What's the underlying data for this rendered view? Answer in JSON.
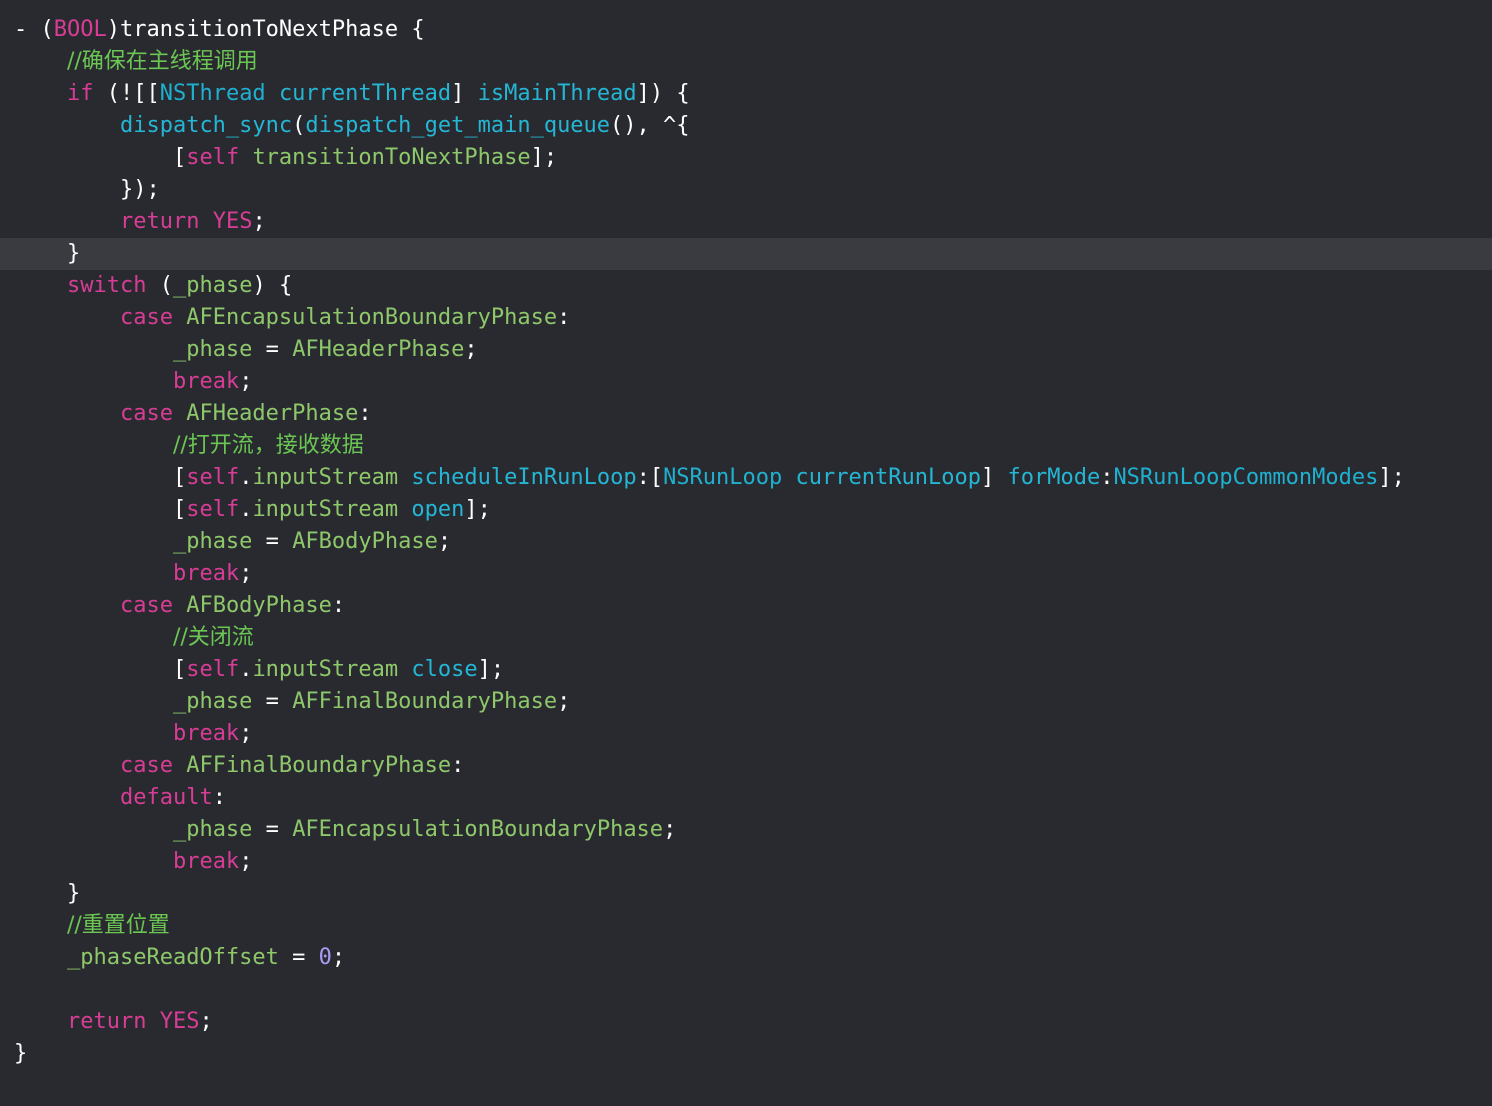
{
  "theme": {
    "background": "#292a30",
    "current_line": "#3a3b40",
    "plain": "#ffffff",
    "keyword": "#d83d96",
    "type": "#1fb0cf",
    "method": "#24b6d4",
    "project_symbol": "#8ec86a",
    "comment": "#6bc653",
    "number": "#a79df5"
  },
  "editor": {
    "current_line_index": 7,
    "lines": [
      {
        "indent": 0,
        "tokens": [
          [
            "plain",
            "- ("
          ],
          [
            "kw",
            "BOOL"
          ],
          [
            "plain",
            ")transitionToNextPhase {"
          ]
        ]
      },
      {
        "indent": 1,
        "tokens": [
          [
            "cmt",
            "//确保在主线程调用"
          ]
        ]
      },
      {
        "indent": 1,
        "tokens": [
          [
            "kw",
            "if"
          ],
          [
            "plain",
            " (![["
          ],
          [
            "type",
            "NSThread"
          ],
          [
            "plain",
            " "
          ],
          [
            "func",
            "currentThread"
          ],
          [
            "plain",
            "] "
          ],
          [
            "func",
            "isMainThread"
          ],
          [
            "plain",
            "]) {"
          ]
        ]
      },
      {
        "indent": 2,
        "tokens": [
          [
            "func",
            "dispatch_sync"
          ],
          [
            "plain",
            "("
          ],
          [
            "func",
            "dispatch_get_main_queue"
          ],
          [
            "plain",
            "(), ^{"
          ]
        ]
      },
      {
        "indent": 3,
        "tokens": [
          [
            "plain",
            "["
          ],
          [
            "kw",
            "self"
          ],
          [
            "plain",
            " "
          ],
          [
            "green",
            "transitionToNextPhase"
          ],
          [
            "plain",
            "];"
          ]
        ]
      },
      {
        "indent": 2,
        "tokens": [
          [
            "plain",
            "});"
          ]
        ]
      },
      {
        "indent": 2,
        "tokens": [
          [
            "kw",
            "return"
          ],
          [
            "plain",
            " "
          ],
          [
            "kw",
            "YES"
          ],
          [
            "plain",
            ";"
          ]
        ]
      },
      {
        "indent": 1,
        "tokens": [
          [
            "plain",
            "}"
          ]
        ]
      },
      {
        "indent": 1,
        "tokens": [
          [
            "kw",
            "switch"
          ],
          [
            "plain",
            " ("
          ],
          [
            "green",
            "_phase"
          ],
          [
            "plain",
            ") {"
          ]
        ]
      },
      {
        "indent": 2,
        "tokens": [
          [
            "kw",
            "case"
          ],
          [
            "plain",
            " "
          ],
          [
            "green",
            "AFEncapsulationBoundaryPhase"
          ],
          [
            "plain",
            ":"
          ]
        ]
      },
      {
        "indent": 3,
        "tokens": [
          [
            "green",
            "_phase"
          ],
          [
            "plain",
            " = "
          ],
          [
            "green",
            "AFHeaderPhase"
          ],
          [
            "plain",
            ";"
          ]
        ]
      },
      {
        "indent": 3,
        "tokens": [
          [
            "kw",
            "break"
          ],
          [
            "plain",
            ";"
          ]
        ]
      },
      {
        "indent": 2,
        "tokens": [
          [
            "kw",
            "case"
          ],
          [
            "plain",
            " "
          ],
          [
            "green",
            "AFHeaderPhase"
          ],
          [
            "plain",
            ":"
          ]
        ]
      },
      {
        "indent": 3,
        "tokens": [
          [
            "cmt",
            "//打开流，接收数据"
          ]
        ]
      },
      {
        "indent": 3,
        "tokens": [
          [
            "plain",
            "["
          ],
          [
            "kw",
            "self"
          ],
          [
            "plain",
            "."
          ],
          [
            "green",
            "inputStream"
          ],
          [
            "plain",
            " "
          ],
          [
            "func",
            "scheduleInRunLoop"
          ],
          [
            "plain",
            ":["
          ],
          [
            "type",
            "NSRunLoop"
          ],
          [
            "plain",
            " "
          ],
          [
            "func",
            "currentRunLoop"
          ],
          [
            "plain",
            "] "
          ],
          [
            "func",
            "forMode"
          ],
          [
            "plain",
            ":"
          ],
          [
            "type",
            "NSRunLoopCommonModes"
          ],
          [
            "plain",
            "];"
          ]
        ]
      },
      {
        "indent": 3,
        "tokens": [
          [
            "plain",
            "["
          ],
          [
            "kw",
            "self"
          ],
          [
            "plain",
            "."
          ],
          [
            "green",
            "inputStream"
          ],
          [
            "plain",
            " "
          ],
          [
            "func",
            "open"
          ],
          [
            "plain",
            "];"
          ]
        ]
      },
      {
        "indent": 3,
        "tokens": [
          [
            "green",
            "_phase"
          ],
          [
            "plain",
            " = "
          ],
          [
            "green",
            "AFBodyPhase"
          ],
          [
            "plain",
            ";"
          ]
        ]
      },
      {
        "indent": 3,
        "tokens": [
          [
            "kw",
            "break"
          ],
          [
            "plain",
            ";"
          ]
        ]
      },
      {
        "indent": 2,
        "tokens": [
          [
            "kw",
            "case"
          ],
          [
            "plain",
            " "
          ],
          [
            "green",
            "AFBodyPhase"
          ],
          [
            "plain",
            ":"
          ]
        ]
      },
      {
        "indent": 3,
        "tokens": [
          [
            "cmt",
            "//关闭流"
          ]
        ]
      },
      {
        "indent": 3,
        "tokens": [
          [
            "plain",
            "["
          ],
          [
            "kw",
            "self"
          ],
          [
            "plain",
            "."
          ],
          [
            "green",
            "inputStream"
          ],
          [
            "plain",
            " "
          ],
          [
            "func",
            "close"
          ],
          [
            "plain",
            "];"
          ]
        ]
      },
      {
        "indent": 3,
        "tokens": [
          [
            "green",
            "_phase"
          ],
          [
            "plain",
            " = "
          ],
          [
            "green",
            "AFFinalBoundaryPhase"
          ],
          [
            "plain",
            ";"
          ]
        ]
      },
      {
        "indent": 3,
        "tokens": [
          [
            "kw",
            "break"
          ],
          [
            "plain",
            ";"
          ]
        ]
      },
      {
        "indent": 2,
        "tokens": [
          [
            "kw",
            "case"
          ],
          [
            "plain",
            " "
          ],
          [
            "green",
            "AFFinalBoundaryPhase"
          ],
          [
            "plain",
            ":"
          ]
        ]
      },
      {
        "indent": 2,
        "tokens": [
          [
            "kw",
            "default"
          ],
          [
            "plain",
            ":"
          ]
        ]
      },
      {
        "indent": 3,
        "tokens": [
          [
            "green",
            "_phase"
          ],
          [
            "plain",
            " = "
          ],
          [
            "green",
            "AFEncapsulationBoundaryPhase"
          ],
          [
            "plain",
            ";"
          ]
        ]
      },
      {
        "indent": 3,
        "tokens": [
          [
            "kw",
            "break"
          ],
          [
            "plain",
            ";"
          ]
        ]
      },
      {
        "indent": 1,
        "tokens": [
          [
            "plain",
            "}"
          ]
        ]
      },
      {
        "indent": 1,
        "tokens": [
          [
            "cmt",
            "//重置位置"
          ]
        ]
      },
      {
        "indent": 1,
        "tokens": [
          [
            "green",
            "_phaseReadOffset"
          ],
          [
            "plain",
            " = "
          ],
          [
            "num",
            "0"
          ],
          [
            "plain",
            ";"
          ]
        ]
      },
      {
        "indent": 0,
        "tokens": []
      },
      {
        "indent": 1,
        "tokens": [
          [
            "kw",
            "return"
          ],
          [
            "plain",
            " "
          ],
          [
            "kw",
            "YES"
          ],
          [
            "plain",
            ";"
          ]
        ]
      },
      {
        "indent": 0,
        "tokens": [
          [
            "plain",
            "}"
          ]
        ]
      }
    ]
  }
}
